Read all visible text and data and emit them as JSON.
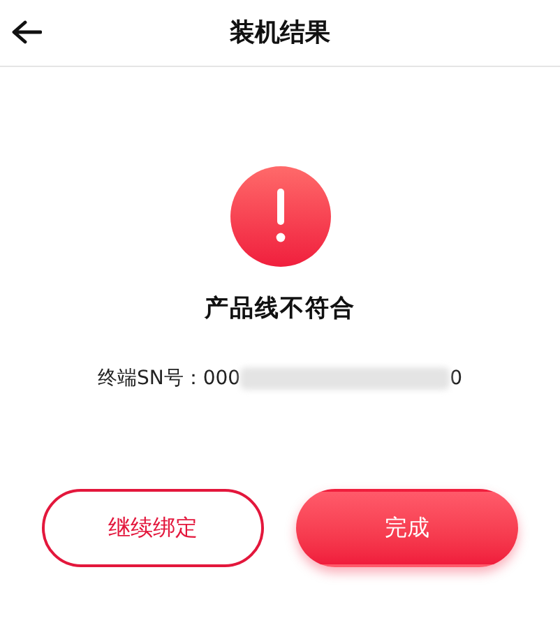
{
  "header": {
    "title": "装机结果"
  },
  "result": {
    "message": "产品线不符合",
    "sn_label": "终端SN号：",
    "sn_prefix": "000",
    "sn_suffix": "0",
    "sn_blurred": true
  },
  "buttons": [
    {
      "label": "继续绑定",
      "kind": "outline"
    },
    {
      "label": "完成",
      "kind": "filled"
    }
  ]
}
